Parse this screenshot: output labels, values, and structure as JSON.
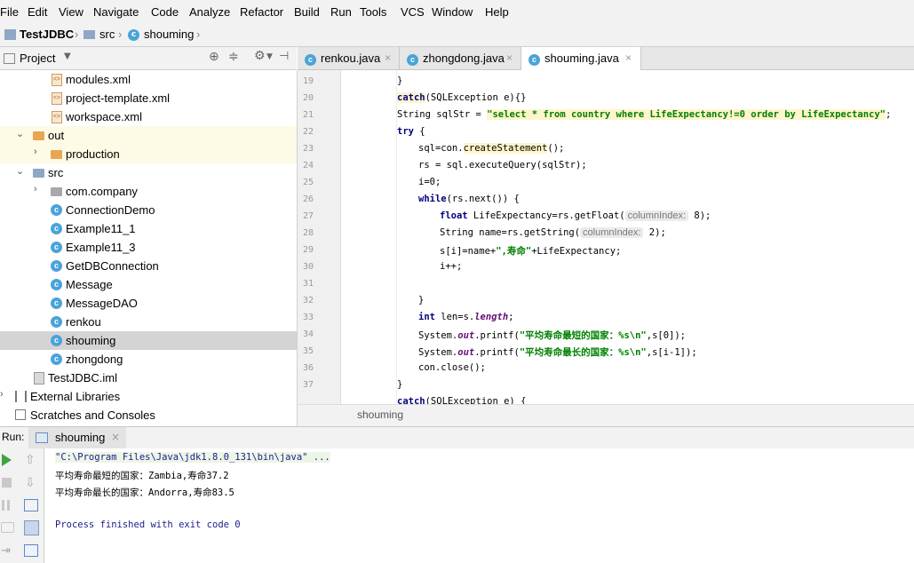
{
  "menu": [
    "File",
    "Edit",
    "View",
    "Navigate",
    "Code",
    "Analyze",
    "Refactor",
    "Build",
    "Run",
    "Tools",
    "VCS",
    "Window",
    "Help"
  ],
  "breadcrumb": {
    "project": "TestJDBC",
    "folder": "src",
    "file": "shouming"
  },
  "project_panel": {
    "title": "Project"
  },
  "tree": [
    {
      "label": "modules.xml"
    },
    {
      "label": "project-template.xml"
    },
    {
      "label": "workspace.xml"
    },
    {
      "label": "out"
    },
    {
      "label": "production"
    },
    {
      "label": "src"
    },
    {
      "label": "com.company"
    },
    {
      "label": "ConnectionDemo"
    },
    {
      "label": "Example11_1"
    },
    {
      "label": "Example11_3"
    },
    {
      "label": "GetDBConnection"
    },
    {
      "label": "Message"
    },
    {
      "label": "MessageDAO"
    },
    {
      "label": "renkou"
    },
    {
      "label": "shouming"
    },
    {
      "label": "zhongdong"
    },
    {
      "label": "TestJDBC.iml"
    },
    {
      "label": "External Libraries"
    },
    {
      "label": "Scratches and Consoles"
    }
  ],
  "tabs": [
    {
      "label": "renkou.java",
      "close": "×"
    },
    {
      "label": "zhongdong.java",
      "close": "×"
    },
    {
      "label": "shouming.java",
      "close": "×"
    }
  ],
  "line_numbers": [
    "19",
    "20",
    "21",
    "22",
    "23",
    "24",
    "25",
    "26",
    "27",
    "28",
    "29",
    "30",
    "31",
    "32",
    "33",
    "34",
    "35",
    "36",
    "37"
  ],
  "code": {
    "l19": "}",
    "l20_kw": "catch",
    "l20_rest": "(SQLException e){}",
    "l21_a": "String sqlStr = ",
    "l21_str": "\"select * from country where LifeExpectancy!=0 order by LifeExpectancy\"",
    "l21_b": ";",
    "l22_kw": "try",
    "l22_rest": " {",
    "l23_a": "sql=con.",
    "l23_b": "createStatement",
    "l23_c": "();",
    "l24": "rs = sql.executeQuery(sqlStr);",
    "l25": "i=0;",
    "l26_kw": "while",
    "l26_rest": "(rs.next()) {",
    "l27_kw": "float",
    "l27_a": " LifeExpectancy=rs.getFloat(",
    "l27_hint": "columnIndex:",
    "l27_b": " 8);",
    "l28_a": "String name=rs.getString(",
    "l28_hint": "columnIndex:",
    "l28_b": " 2);",
    "l29_a": "s[i]=name+",
    "l29_str": "\",寿命\"",
    "l29_b": "+LifeExpectancy;",
    "l30": "i++;",
    "l32": "}",
    "l33_kw": "int",
    "l33_a": " len=s.",
    "l33_fld": "length",
    "l33_b": ";",
    "l34_a": "System.",
    "l34_fld": "out",
    "l34_b": ".printf(",
    "l34_str": "\"平均寿命最短的国家：%s\\n\"",
    "l34_c": ",s[0]);",
    "l35_a": "System.",
    "l35_fld": "out",
    "l35_b": ".printf(",
    "l35_str": "\"平均寿命最长的国家：%s\\n\"",
    "l35_c": ",s[i-1]);",
    "l36": "con.close();",
    "l37": "}",
    "l38_kw": "catch",
    "l38_rest": "(SQLException e) {"
  },
  "editor_crumb": "shouming",
  "run": {
    "label": "Run:",
    "tab": "shouming",
    "cmd": "\"C:\\Program Files\\Java\\jdk1.8.0_131\\bin\\java\" ...",
    "out1": "平均寿命最短的国家：Zambia,寿命37.2",
    "out2": "平均寿命最长的国家：Andorra,寿命83.5",
    "exit": "Process finished with exit code 0"
  }
}
